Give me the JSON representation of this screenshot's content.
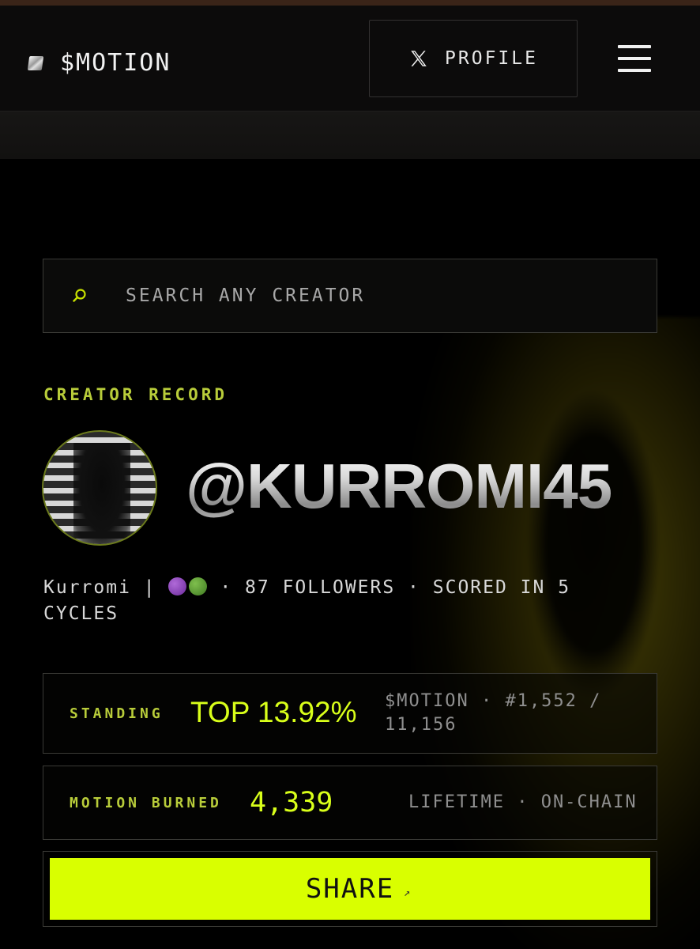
{
  "nav": {
    "logo_text": "$MOTION",
    "profile_label": "PROFILE",
    "profile_icon": "x-logo-icon",
    "menu_icon": "hamburger-menu-icon"
  },
  "search": {
    "placeholder": "SEARCH ANY CREATOR",
    "icon": "search-icon"
  },
  "creator": {
    "section_label": "CREATOR RECORD",
    "handle": "@KURROMI45",
    "display_name": "Kurromi |",
    "meta_followers": "· 87 FOLLOWERS · SCORED IN 5",
    "meta_cycles": "CYCLES"
  },
  "standing": {
    "label": "STANDING",
    "value": "TOP 13.92%",
    "note_line1": "$MOTION · #1,552 /",
    "note_line2": "11,156"
  },
  "burned": {
    "label": "MOTION BURNED",
    "value": "4,339",
    "note": "LIFETIME · ON-CHAIN"
  },
  "share": {
    "label": "SHARE",
    "arrow": "↗"
  },
  "colors": {
    "accent": "#d9ff00",
    "label_green": "#b8cc3a",
    "background": "#000000"
  }
}
